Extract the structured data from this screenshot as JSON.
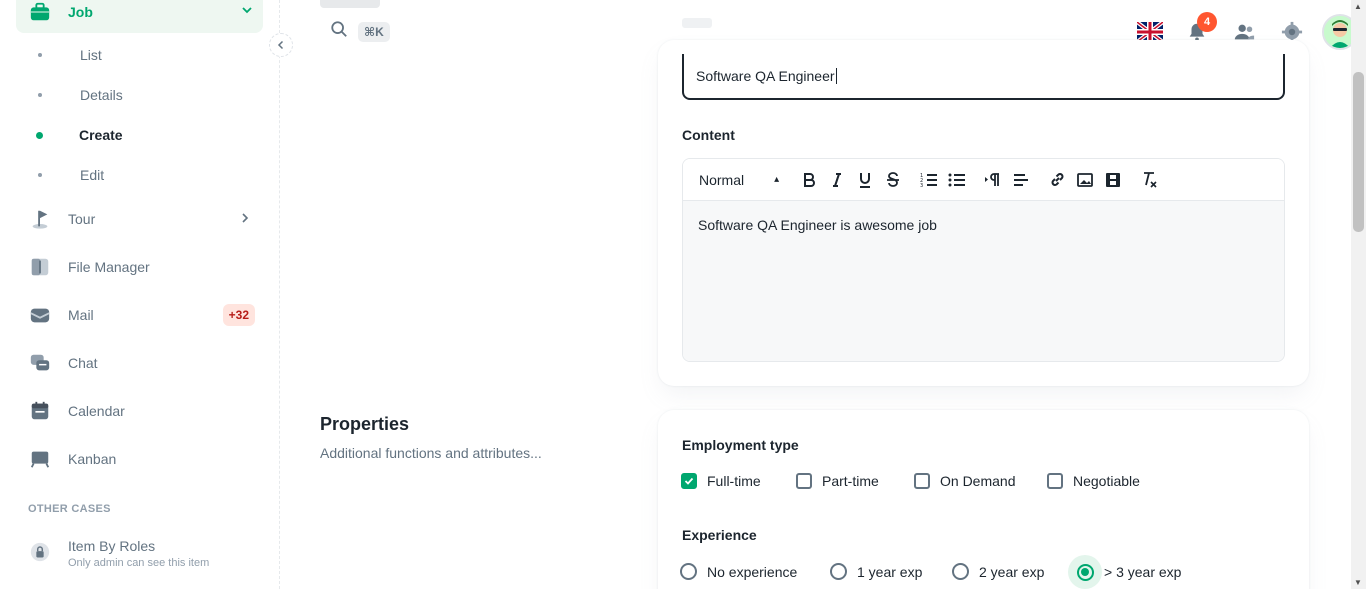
{
  "sidebar": {
    "job": {
      "label": "Job"
    },
    "job_sub": [
      {
        "label": "List"
      },
      {
        "label": "Details"
      },
      {
        "label": "Create"
      },
      {
        "label": "Edit"
      }
    ],
    "items": [
      {
        "label": "Tour",
        "icon": "tour-flag-icon"
      },
      {
        "label": "File Manager",
        "icon": "file-manager-icon"
      },
      {
        "label": "Mail",
        "icon": "mail-icon",
        "badge": "+32"
      },
      {
        "label": "Chat",
        "icon": "chat-icon"
      },
      {
        "label": "Calendar",
        "icon": "calendar-icon"
      },
      {
        "label": "Kanban",
        "icon": "kanban-icon"
      }
    ],
    "other_cases_title": "OTHER CASES",
    "item_by_roles": {
      "label": "Item By Roles",
      "caption": "Only admin can see this item"
    }
  },
  "header": {
    "search_shortcut": "⌘K",
    "notifications_count": "4"
  },
  "form": {
    "title_value": "Software QA Engineer",
    "content_label": "Content",
    "editor": {
      "block_format": "Normal",
      "body": "Software QA Engineer is awesome job"
    },
    "properties": {
      "title": "Properties",
      "subtitle": "Additional functions and attributes..."
    },
    "employment_type": {
      "label": "Employment type",
      "options": [
        "Full-time",
        "Part-time",
        "On Demand",
        "Negotiable"
      ],
      "checked": [
        "Full-time"
      ]
    },
    "experience": {
      "label": "Experience",
      "options": [
        "No experience",
        "1 year exp",
        "2 year exp",
        "> 3 year exp"
      ],
      "selected": "> 3 year exp"
    }
  },
  "colors": {
    "primary": "#00a76f",
    "primary_light": "#eef7f1",
    "text": "#1c252e",
    "text_secondary": "#637381",
    "error_badge": "#ff5630"
  }
}
